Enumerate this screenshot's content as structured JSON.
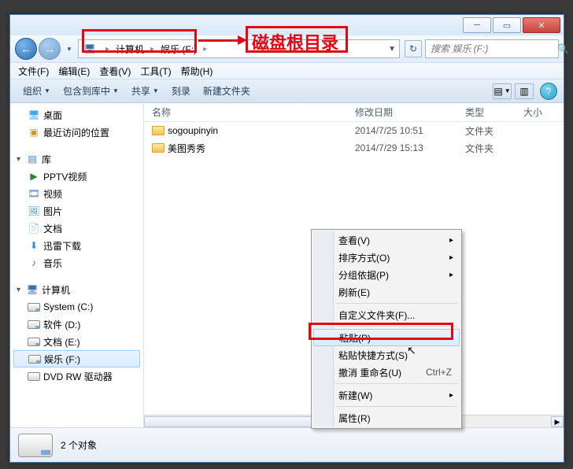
{
  "breadcrumb": {
    "seg1": "计算机",
    "seg2": "娱乐 (F:)"
  },
  "search": {
    "placeholder": "搜索 娱乐 (F:)"
  },
  "menubar": {
    "file": "文件(F)",
    "edit": "编辑(E)",
    "view": "查看(V)",
    "tools": "工具(T)",
    "help": "帮助(H)"
  },
  "toolbar": {
    "org": "组织",
    "include": "包含到库中",
    "share": "共享",
    "burn": "刻录",
    "newfolder": "新建文件夹"
  },
  "nav": {
    "desktop": "桌面",
    "recent": "最近访问的位置",
    "lib": "库",
    "pptv": "PPTV视频",
    "videos": "视频",
    "pictures": "图片",
    "docs": "文档",
    "xunlei": "迅雷下载",
    "music": "音乐",
    "computer": "计算机",
    "c": "System (C:)",
    "d": "软件 (D:)",
    "e": "文档 (E:)",
    "f": "娱乐 (F:)",
    "dvd": "DVD RW 驱动器"
  },
  "cols": {
    "name": "名称",
    "date": "修改日期",
    "type": "类型",
    "size": "大小"
  },
  "rows": [
    {
      "name": "sogoupinyin",
      "date": "2014/7/25 10:51",
      "type": "文件夹"
    },
    {
      "name": "美图秀秀",
      "date": "2014/7/29 15:13",
      "type": "文件夹"
    }
  ],
  "ctx": {
    "view": "查看(V)",
    "sort": "排序方式(O)",
    "group": "分组依据(P)",
    "refresh": "刷新(E)",
    "customize": "自定义文件夹(F)...",
    "paste": "粘贴(P)",
    "pastesc": "粘贴快捷方式(S)",
    "undo": "撤消 重命名(U)",
    "undokey": "Ctrl+Z",
    "new": "新建(W)",
    "props": "属性(R)"
  },
  "status": {
    "count": "2 个对象"
  },
  "annotation": {
    "label": "磁盘根目录"
  }
}
